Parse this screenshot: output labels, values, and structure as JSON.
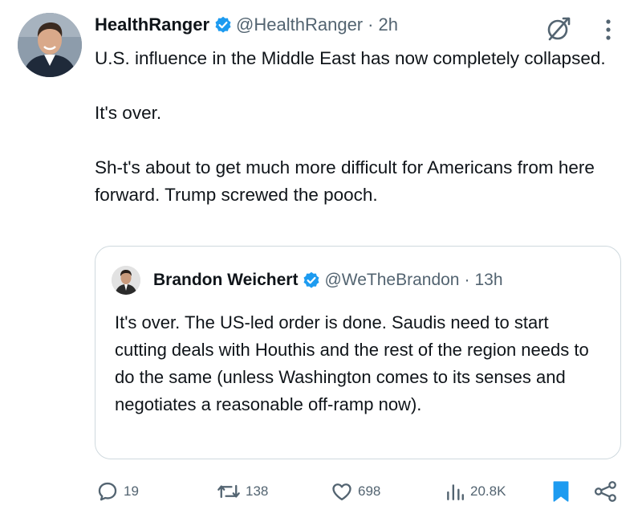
{
  "tweet": {
    "author": {
      "display_name": "HealthRanger",
      "handle": "@HealthRanger",
      "verified": true
    },
    "separator": "·",
    "time": "2h",
    "paragraphs": [
      "U.S. influence in the Middle East has now completely collapsed.",
      "It's over.",
      "Sh-t's about to get much more difficult for Americans from here forward. Trump screwed the pooch."
    ],
    "icons": {
      "grok": "grok-icon",
      "more": "more-vertical-icon"
    }
  },
  "quote": {
    "author": {
      "display_name": "Brandon Weichert",
      "handle": "@WeTheBrandon",
      "verified": true
    },
    "separator": "·",
    "time": "13h",
    "text": "It's over. The US-led order is done. Saudis need to start cutting deals with Houthis and the rest of the region needs to do the same (unless Washington comes to its senses and negotiates a reasonable off-ramp now)."
  },
  "actions": {
    "replies": "19",
    "reposts": "138",
    "likes": "698",
    "views": "20.8K",
    "icons": [
      "reply-icon",
      "repost-icon",
      "like-icon",
      "views-icon",
      "bookmark-icon",
      "share-icon"
    ]
  },
  "colors": {
    "text": "#0f1419",
    "secondary": "#536471",
    "verified": "#1d9bf0",
    "bookmark": "#1d9bf0",
    "border": "#cfd9de"
  }
}
